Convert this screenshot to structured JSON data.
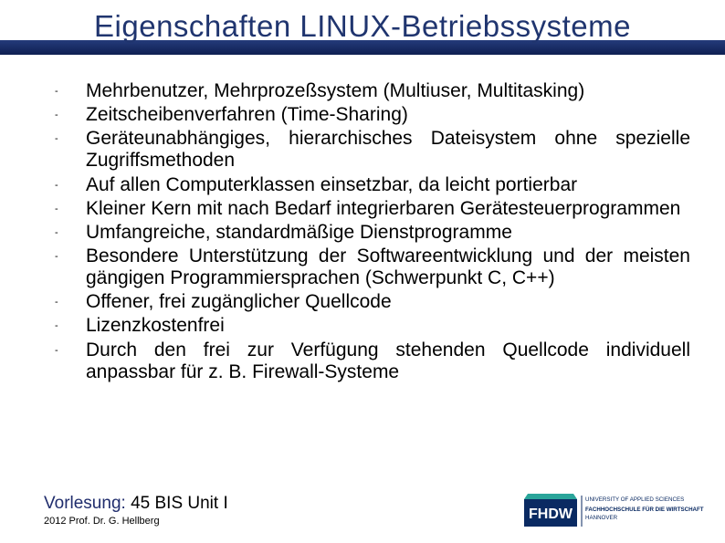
{
  "title": "Eigenschaften LINUX-Betriebssysteme",
  "bullets": [
    "Mehrbenutzer, Mehrprozeßsystem (Multiuser, Multitasking)",
    "Zeitscheibenverfahren (Time-Sharing)",
    "Geräteunabhängiges, hierarchisches Dateisystem ohne spezielle Zugriffsmethoden",
    "Auf allen Computerklassen einsetzbar, da leicht portierbar",
    "Kleiner Kern mit nach Bedarf integrierbaren Gerätesteuerprogrammen",
    "Umfangreiche, standardmäßige Dienstprogramme",
    "Besondere Unterstützung der Softwareentwicklung und der meisten gängigen Programmiersprachen (Schwerpunkt C, C++)",
    "Offener, frei zugänglicher Quellcode",
    "Lizenzkostenfrei",
    "Durch den frei zur Verfügung stehenden Quellcode individuell anpassbar für z. B. Firewall-Systeme"
  ],
  "footer": {
    "lecture_label": "Vorlesung:",
    "lecture_value": "45 BIS Unit I",
    "sub": "2012 Prof. Dr. G. Hellberg"
  },
  "logo": {
    "abbr": "FHDW",
    "line1": "UNIVERSITY OF APPLIED SCIENCES",
    "line2": "FACHHOCHSCHULE FÜR DIE WIRTSCHAFT",
    "line3": "HANNOVER"
  },
  "colors": {
    "title": "#20356f",
    "band_top": "#243b7a",
    "band_bottom": "#0f1f52",
    "logo_blue": "#0a2a62",
    "logo_teal": "#2aa59a"
  }
}
